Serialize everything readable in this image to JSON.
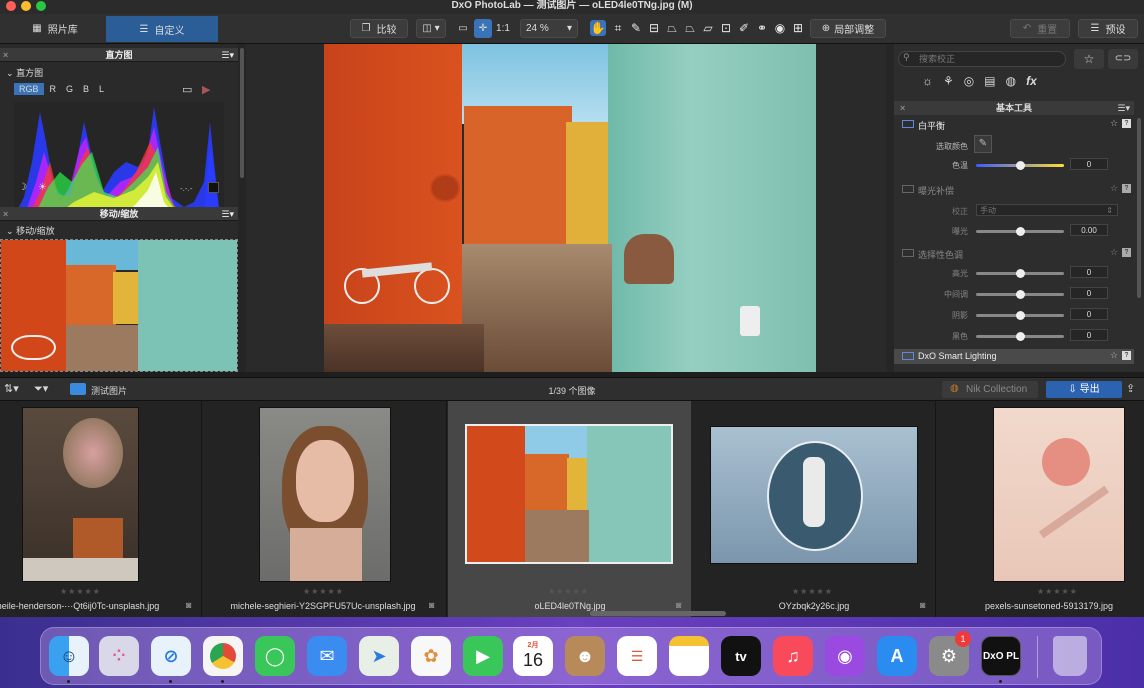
{
  "window": {
    "title": "DxO PhotoLab — 测试图片 — oLED4le0TNg.jpg (M)"
  },
  "toolbar": {
    "library_tab": "照片库",
    "customize_tab": "自定义",
    "compare": "比较",
    "fit": "1:1",
    "zoom": "24 %",
    "local_adjust": "局部调整",
    "reset": "重置",
    "presets": "预设"
  },
  "left": {
    "histogram_header": "直方图",
    "histogram_sub": "直方图",
    "channels": [
      "RGB",
      "R",
      "G",
      "B",
      "L"
    ],
    "histogram_readout": "-.-.-",
    "move_header": "移动/缩放",
    "move_sub": "移动/缩放"
  },
  "right": {
    "search_placeholder": "搜索校正",
    "basic_tools_header": "基本工具",
    "white_balance": "白平衡",
    "pick_color": "选取颜色",
    "temperature": "色温",
    "temperature_value": "0",
    "exposure_comp": "曝光补偿",
    "correction_label": "校正",
    "correction_value": "手动",
    "exposure_label": "曝光",
    "exposure_value": "0.00",
    "selective_tone": "选择性色调",
    "highlights": "高光",
    "highlights_value": "0",
    "midtones": "中间调",
    "midtones_value": "0",
    "shadows": "阴影",
    "shadows_value": "0",
    "blacks": "黑色",
    "blacks_value": "0",
    "smart_lighting": "DxO Smart Lighting"
  },
  "filmbar": {
    "folder": "测试图片",
    "counter": "1/39 个图像",
    "nik": "Nik Collection",
    "export": "导出"
  },
  "thumbnails": [
    {
      "name": "neile-henderson-···Qt6ij0Tc-unsplash.jpg",
      "stars": "★★★★★"
    },
    {
      "name": "michele-seghieri-Y2SGPFU57Uc-unsplash.jpg",
      "stars": "★★★★★"
    },
    {
      "name": "oLED4le0TNg.jpg",
      "stars": "★★★★★"
    },
    {
      "name": "OYzbqk2y26c.jpg",
      "stars": "★★★★★"
    },
    {
      "name": "pexels-sunsetoned-5913179.jpg",
      "stars": "★★★★★"
    }
  ],
  "dock": {
    "calendar_month": "2月",
    "calendar_day": "16",
    "settings_badge": "1",
    "appletv_label": "tv",
    "dxo_label": "DxO PL"
  }
}
